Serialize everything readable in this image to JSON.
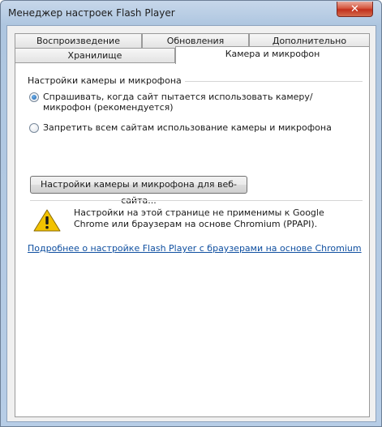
{
  "window": {
    "title": "Менеджер настроек Flash Player",
    "close_label": "✕"
  },
  "tabs": {
    "row1": [
      "Воспроизведение",
      "Обновления",
      "Дополнительно"
    ],
    "row2": [
      "Хранилище",
      "Камера и микрофон"
    ],
    "active": "Камера и микрофон"
  },
  "camera_settings": {
    "group_label": "Настройки камеры и микрофона",
    "options": [
      {
        "label": "Спрашивать, когда сайт пытается использовать камеру/микрофон (рекомендуется)",
        "selected": true
      },
      {
        "label": "Запретить всем сайтам использование камеры и микрофона",
        "selected": false
      }
    ],
    "site_settings_button": "Настройки камеры и микрофона для веб-сайта...",
    "warning_text": "Настройки на этой странице не применимы к Google Chrome или браузерам на основе Chromium (PPAPI).",
    "help_link": "Подробнее о настройке Flash Player с браузерами на основе Chromium"
  },
  "colors": {
    "link": "#0f4fa0",
    "warning_icon": "#f2c200",
    "close_button": "#c1301c"
  }
}
